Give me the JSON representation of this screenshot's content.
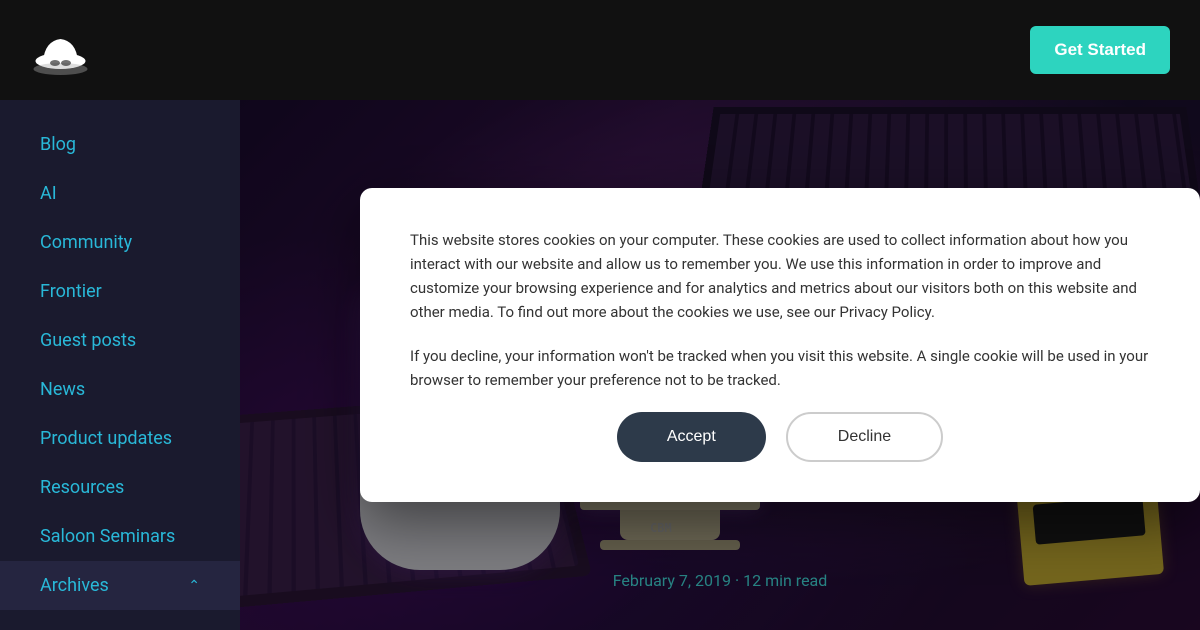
{
  "header": {
    "get_started_label": "Get Started"
  },
  "sidebar": {
    "items": [
      {
        "label": "Blog",
        "id": "blog"
      },
      {
        "label": "AI",
        "id": "ai"
      },
      {
        "label": "Community",
        "id": "community"
      },
      {
        "label": "Frontier",
        "id": "frontier"
      },
      {
        "label": "Guest posts",
        "id": "guest-posts"
      },
      {
        "label": "News",
        "id": "news"
      },
      {
        "label": "Product updates",
        "id": "product-updates"
      },
      {
        "label": "Resources",
        "id": "resources"
      },
      {
        "label": "Saloon Seminars",
        "id": "saloon-seminars"
      },
      {
        "label": "Archives",
        "id": "archives"
      }
    ]
  },
  "cookie_modal": {
    "text1": "This website stores cookies on your computer. These cookies are used to collect information about how you interact with our website and allow us to remember you. We use this information in order to improve and customize your browsing experience and for analytics and metrics about our visitors both on this website and other media. To find out more about the cookies we use, see our Privacy Policy.",
    "text2": "If you decline, your information won't be tracked when you visit this website. A single cookie will be used in your browser to remember your preference not to be tracked.",
    "accept_label": "Accept",
    "decline_label": "Decline"
  },
  "article": {
    "date": "February 7, 2019",
    "read_time": "12 min read",
    "date_separator": "·"
  }
}
